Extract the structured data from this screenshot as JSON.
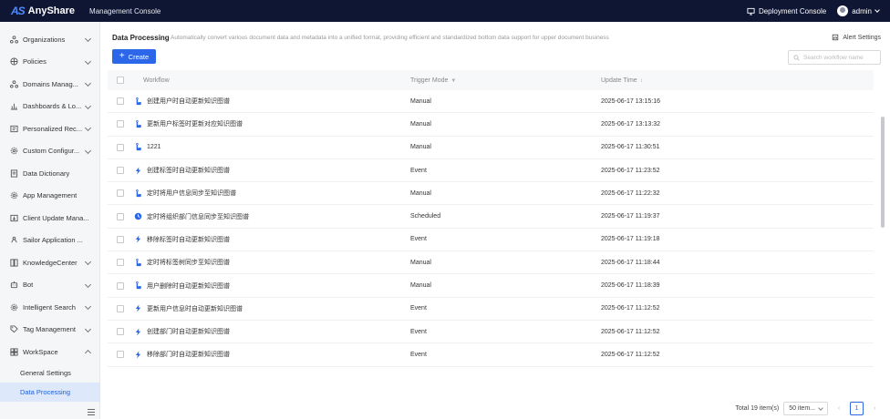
{
  "topbar": {
    "logo_mark": "AS",
    "logo_text": "AnyShare",
    "console_title": "Management Console",
    "deployment_console": "Deployment Console",
    "user": "admin"
  },
  "sidebar": {
    "items": [
      {
        "label": "Organizations",
        "icon": "org-icon",
        "expandable": true
      },
      {
        "label": "Policies",
        "icon": "policy-icon",
        "expandable": true
      },
      {
        "label": "Domains Manag...",
        "icon": "domain-icon",
        "expandable": true
      },
      {
        "label": "Dashboards & Lo...",
        "icon": "dashboard-icon",
        "expandable": true
      },
      {
        "label": "Personalized Rec...",
        "icon": "personalized-icon",
        "expandable": true
      },
      {
        "label": "Custom Configur...",
        "icon": "custom-config-icon",
        "expandable": true
      },
      {
        "label": "Data Dictionary",
        "icon": "dictionary-icon",
        "expandable": false
      },
      {
        "label": "App Management",
        "icon": "app-icon",
        "expandable": false
      },
      {
        "label": "Client Update Mana...",
        "icon": "client-update-icon",
        "expandable": false
      },
      {
        "label": "Sailor Application ...",
        "icon": "sailor-icon",
        "expandable": false
      },
      {
        "label": "KnowledgeCenter",
        "icon": "knowledge-icon",
        "expandable": true
      },
      {
        "label": "Bot",
        "icon": "bot-icon",
        "expandable": true
      },
      {
        "label": "Intelligent Search",
        "icon": "search-ai-icon",
        "expandable": true
      },
      {
        "label": "Tag Management",
        "icon": "tag-icon",
        "expandable": true
      },
      {
        "label": "WorkSpace",
        "icon": "workspace-icon",
        "expandable": true,
        "expanded": true
      }
    ],
    "sub_items": [
      {
        "label": "General Settings",
        "active": false
      },
      {
        "label": "Data Processing",
        "active": true
      }
    ]
  },
  "main": {
    "title": "Data Processing",
    "description": "Automatically convert various document data and metadata into a unified format, providing efficient and standardized bottom data support for upper document business",
    "alert_settings": "Alert Settings",
    "create_label": "Create",
    "search_placeholder": "Search workflow name",
    "columns": {
      "workflow": "Workflow",
      "trigger": "Trigger Mode",
      "time": "Update Time"
    },
    "rows": [
      {
        "name": "创建用户时自动更新知识图谱",
        "mode": "Manual",
        "time": "2025-06-17 13:15:16",
        "icon": "manual-icon"
      },
      {
        "name": "更新用户标签时更新对应知识图谱",
        "mode": "Manual",
        "time": "2025-06-17 13:13:32",
        "icon": "manual-icon"
      },
      {
        "name": "1221",
        "mode": "Manual",
        "time": "2025-06-17 11:30:51",
        "icon": "manual-icon"
      },
      {
        "name": "创建标签时自动更新知识图谱",
        "mode": "Event",
        "time": "2025-06-17 11:23:52",
        "icon": "event-icon"
      },
      {
        "name": "定时将用户信息同步至知识图谱",
        "mode": "Manual",
        "time": "2025-06-17 11:22:32",
        "icon": "manual-icon"
      },
      {
        "name": "定时将组织部门信息同步至知识图谱",
        "mode": "Scheduled",
        "time": "2025-06-17 11:19:37",
        "icon": "scheduled-icon"
      },
      {
        "name": "移除标签时自动更新知识图谱",
        "mode": "Event",
        "time": "2025-06-17 11:19:18",
        "icon": "event-icon"
      },
      {
        "name": "定时将标签树同步至知识图谱",
        "mode": "Manual",
        "time": "2025-06-17 11:18:44",
        "icon": "manual-icon"
      },
      {
        "name": "用户删除时自动更新知识图谱",
        "mode": "Manual",
        "time": "2025-06-17 11:18:39",
        "icon": "manual-icon"
      },
      {
        "name": "更新用户信息时自动更新知识图谱",
        "mode": "Event",
        "time": "2025-06-17 11:12:52",
        "icon": "event-icon"
      },
      {
        "name": "创建部门时自动更新知识图谱",
        "mode": "Event",
        "time": "2025-06-17 11:12:52",
        "icon": "event-icon"
      },
      {
        "name": "移除部门时自动更新知识图谱",
        "mode": "Event",
        "time": "2025-06-17 11:12:52",
        "icon": "event-icon"
      }
    ],
    "pagination": {
      "total": "Total 19 item(s)",
      "page_size": "50 item...",
      "current": "1"
    }
  },
  "colors": {
    "accent": "#2b67e8",
    "topbar": "#0f1633",
    "sidebar": "#f5f6f8",
    "active_bg": "#dde8fb"
  }
}
